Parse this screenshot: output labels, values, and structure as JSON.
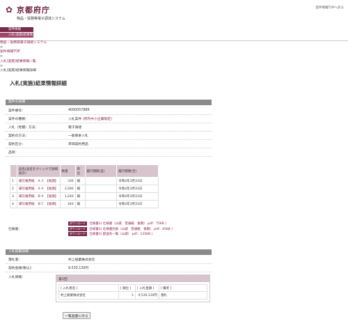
{
  "header": {
    "logo_text": "京都府庁",
    "system_name": "物品・役務等電子調達システム",
    "top_link": "案件情報TOPへ戻る"
  },
  "nav": {
    "tabs": [
      {
        "label": "案件情報"
      },
      {
        "label": "入札(実施)結果情報"
      }
    ]
  },
  "breadcrumb": {
    "items": [
      "物品・役務等電子調達システム",
      "案件情報TOP",
      "入札(実施)結果情報一覧",
      "入札(実施)結果情報詳細"
    ],
    "separator": ">"
  },
  "page_title": "入札(実施)結果情報詳細",
  "case_info": {
    "section_title": "案件の詳細",
    "rows": [
      {
        "label": "案件番号：",
        "value": "4000057886"
      },
      {
        "label": "案件の種類：",
        "value": "入札案件",
        "tag": "(府内中小企業限定)"
      },
      {
        "label": "入札（見積）方法：",
        "value": "電子調達"
      },
      {
        "label": "契約の方法：",
        "value": "一般競争入札"
      },
      {
        "label": "契約区分：",
        "value": "単価契約用品"
      },
      {
        "label": "品目：",
        "value": ""
      }
    ]
  },
  "items_table": {
    "headers": [
      "",
      "品名(品名をクリックで詳細表示)",
      "数量",
      "単位",
      "履行期間(自)",
      "履行期間(至)"
    ],
    "rows": [
      {
        "no": "1",
        "name": "補写複用紙　Ａ３　【後期】",
        "qty": "330",
        "unit": "箱",
        "start": "",
        "end": "令和4年3月31日"
      },
      {
        "no": "2",
        "name": "補写複用紙　Ａ４　【後期】",
        "qty": "3,590",
        "unit": "箱",
        "start": "",
        "end": "令和4年3月31日"
      },
      {
        "no": "3",
        "name": "補写複用紙　Ｂ４　【後期】",
        "qty": "1,240",
        "unit": "箱",
        "start": "",
        "end": "令和4年3月31日"
      },
      {
        "no": "4",
        "name": "補写複用紙　Ｂ５　【後期】",
        "qty": "340",
        "unit": "箱",
        "start": "",
        "end": "令和4年3月31日"
      }
    ]
  },
  "spec": {
    "label": "仕様書：",
    "badge": "ダウンロード",
    "files": [
      "仕様書1( 仕様書（山城　普通紙　後期）.pdf：75KB )",
      "仕様書2( 仕様書別表（山城　普通紙　後期）.pdf：45KB )",
      "仕様書3( 配送先一覧（山城）.pdf：135KB )"
    ]
  },
  "result_info": {
    "section_title": "入札結果詳細",
    "winner_label": "落札者：",
    "winner_value": "村上紙業株式会社",
    "amount_label": "契約金額(税込)：",
    "amount_value": "9,530,130円",
    "bid_label": "入札情報：",
    "round_label": "第1回",
    "headers": [
      "[ 入札者名 ]",
      "[ 順位 ]",
      "[ 入札金額 ]",
      "[ 備考 ]"
    ],
    "rows": [
      {
        "name": "村上紙業株式会社",
        "rank": "1",
        "amount": "9,530,130円",
        "note": "落札"
      }
    ]
  },
  "back_button": "一覧画面に戻る"
}
